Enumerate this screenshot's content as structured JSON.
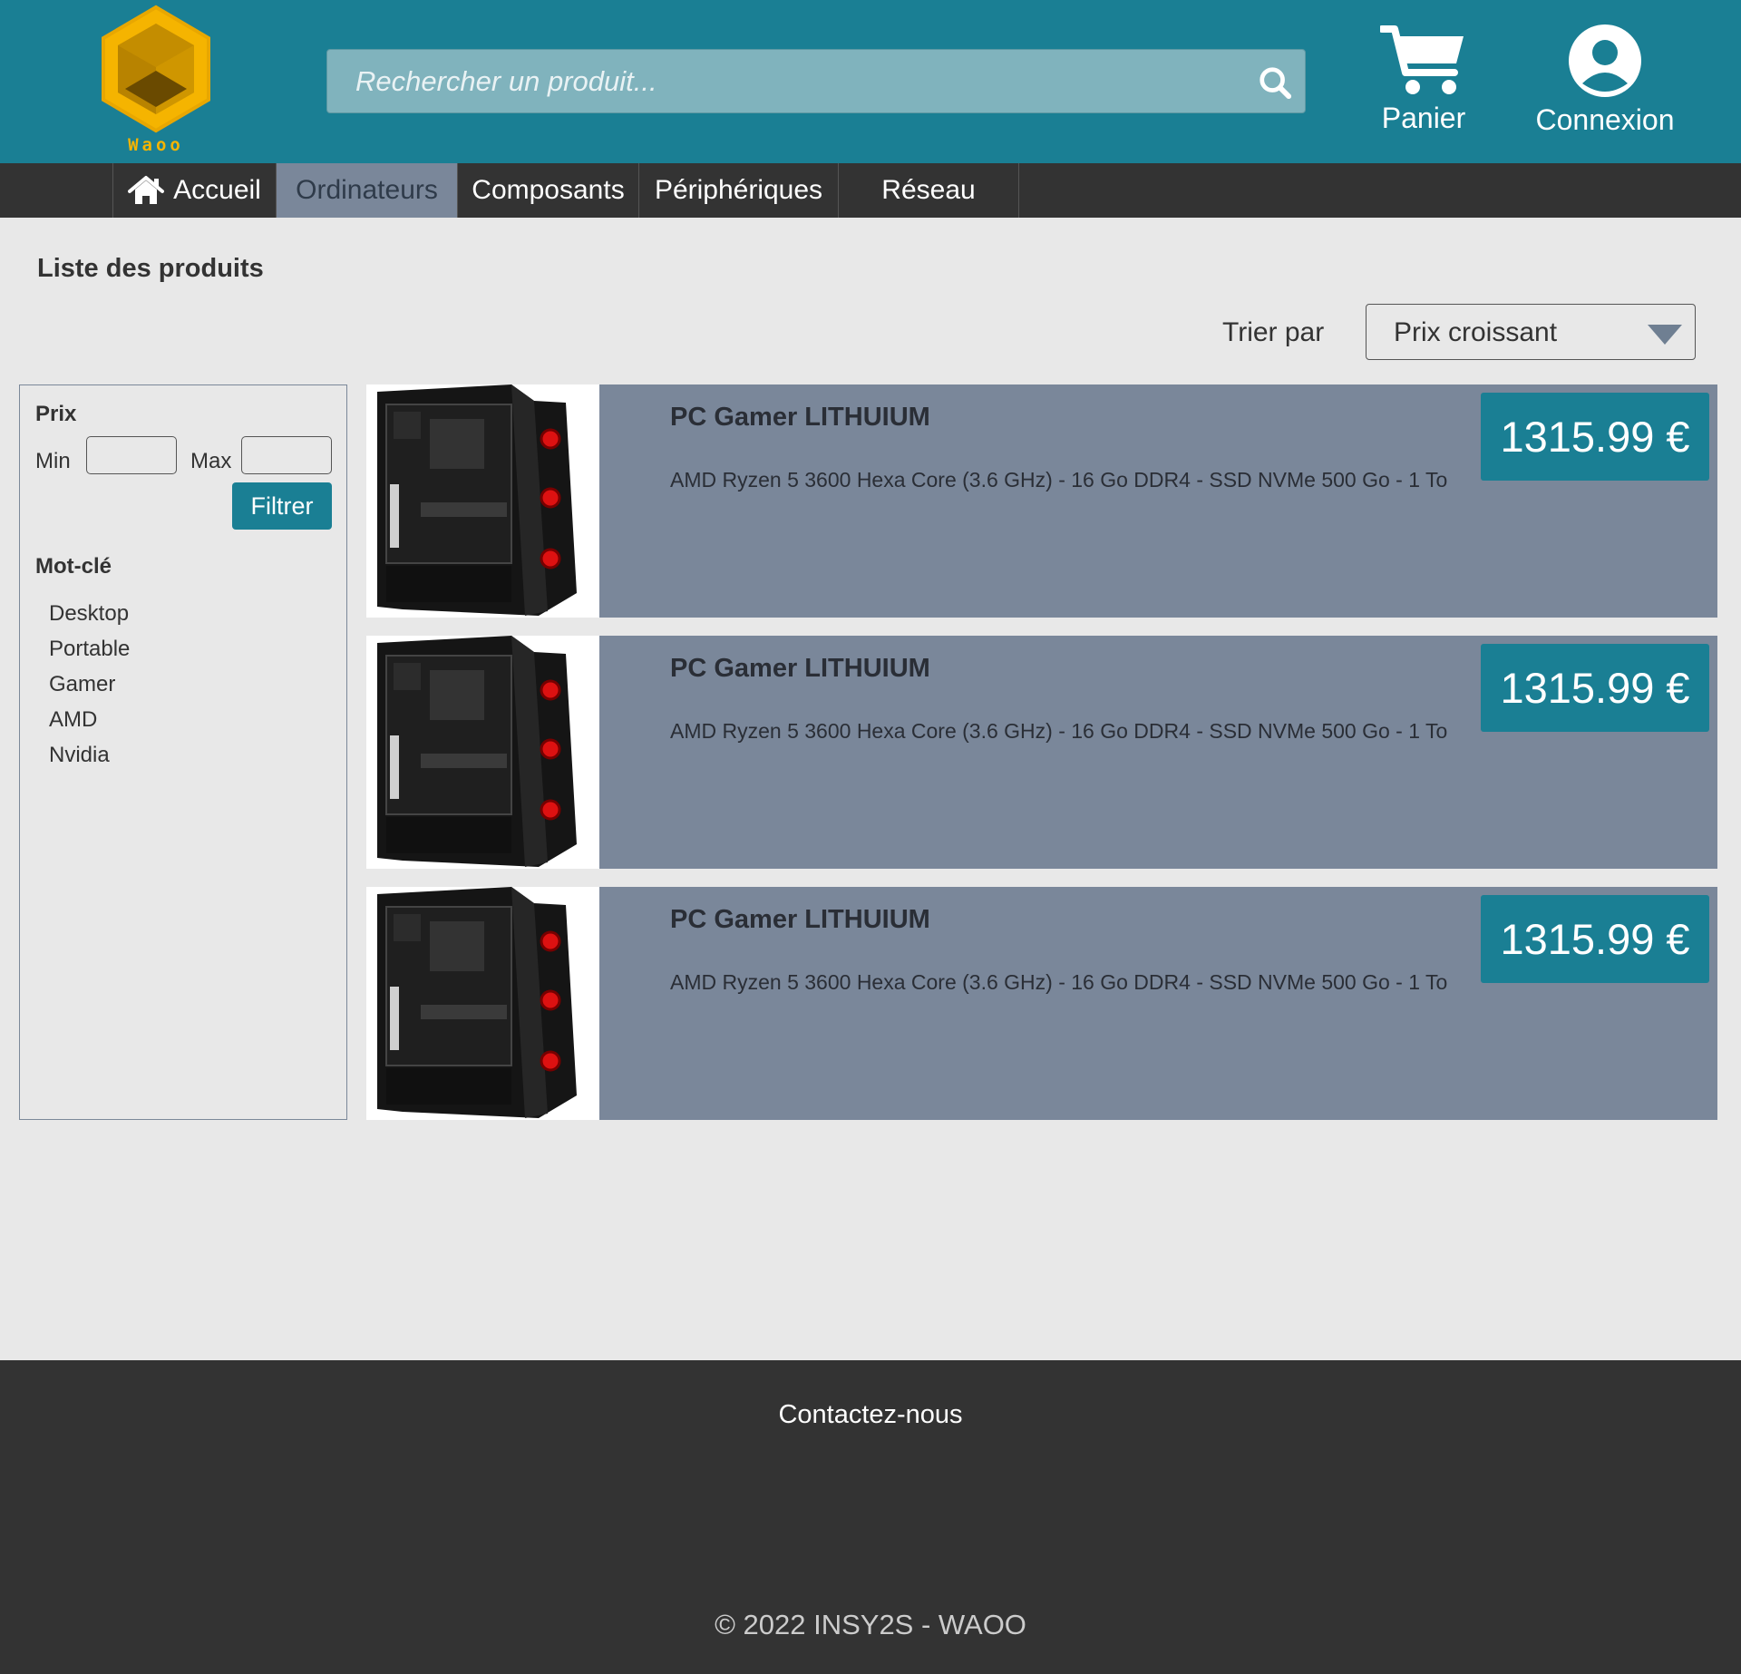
{
  "header": {
    "logo_text": "Waoo",
    "search_placeholder": "Rechercher un produit...",
    "cart_label": "Panier",
    "login_label": "Connexion",
    "icons": {
      "search": "search-icon",
      "cart": "cart-icon",
      "login": "user-circle-icon"
    }
  },
  "nav": {
    "items": [
      {
        "label": "Accueil",
        "icon": "home-icon"
      },
      {
        "label": "Ordinateurs"
      },
      {
        "label": "Composants"
      },
      {
        "label": "Périphériques"
      },
      {
        "label": "Réseau"
      }
    ],
    "active_index": 1
  },
  "main": {
    "title": "Liste des produits",
    "sort_label": "Trier par",
    "sort_value": "Prix croissant"
  },
  "sidebar": {
    "price_heading": "Prix",
    "min_label": "Min",
    "max_label": "Max",
    "min_value": "",
    "max_value": "",
    "filter_button": "Filtrer",
    "keyword_heading": "Mot-clé",
    "keywords": [
      "Desktop",
      "Portable",
      "Gamer",
      "AMD",
      "Nvidia"
    ]
  },
  "products": [
    {
      "name": "PC Gamer LITHUIUM",
      "description": "AMD Ryzen 5 3600 Hexa Core (3.6 GHz) - 16 Go DDR4 - SSD NVMe 500 Go - 1 To",
      "price": "1315.99 €"
    },
    {
      "name": "PC Gamer LITHUIUM",
      "description": "AMD Ryzen 5 3600 Hexa Core (3.6 GHz) - 16 Go DDR4 - SSD NVMe 500 Go - 1 To",
      "price": "1315.99 €"
    },
    {
      "name": "PC Gamer LITHUIUM",
      "description": "AMD Ryzen 5 3600 Hexa Core (3.6 GHz) - 16 Go DDR4 - SSD NVMe 500 Go - 1 To",
      "price": "1315.99 €"
    }
  ],
  "footer": {
    "contact": "Contactez-nous",
    "copyright": "© 2022 INSY2S - WAOO"
  },
  "colors": {
    "header_bg": "#1a7f94",
    "nav_bg": "#333333",
    "card_bg": "#7a879a",
    "price_bg": "#1a7f94",
    "logo_gold": "#f5b400"
  }
}
